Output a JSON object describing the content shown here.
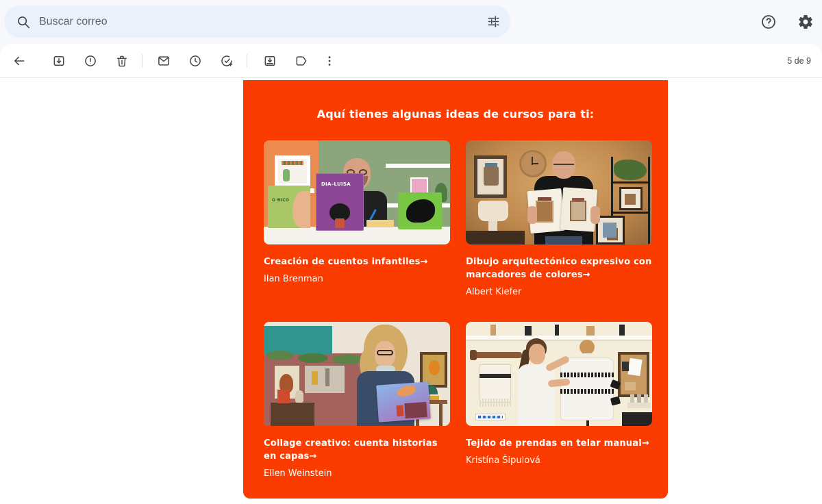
{
  "colors": {
    "brand_orange": "#FA3C00",
    "topbar_bg": "#f6f8fc",
    "search_pill_bg": "#eaf1fb",
    "icon_gray": "#444746",
    "email_text": "#ffffff"
  },
  "topbar": {
    "search_placeholder": "Buscar correo"
  },
  "toolbar": {
    "pagination": "5 de 9"
  },
  "email": {
    "heading": "Aquí tienes algunas ideas de cursos para ti:",
    "courses": [
      {
        "title": "Creación de cuentos infantiles→",
        "author": "Ilan Brenman",
        "image": "man-with-childrens-books-at-desk"
      },
      {
        "title": "Dibujo arquitectónico expresivo con marcadores de colores→",
        "author": "Albert Kiefer",
        "image": "man-holding-architecture-sketchbook"
      },
      {
        "title": "Collage creativo: cuenta historias en capas→",
        "author": "Ellen Weinstein",
        "image": "woman-holding-collage-artwork"
      },
      {
        "title": "Tejido de prendas en telar manual→",
        "author": "Kristína Šipulová",
        "image": "woman-with-mannequin-woven-garment"
      }
    ],
    "photo_texts": {
      "book1": "O BICO",
      "book2": "DIA–LUISA"
    }
  }
}
